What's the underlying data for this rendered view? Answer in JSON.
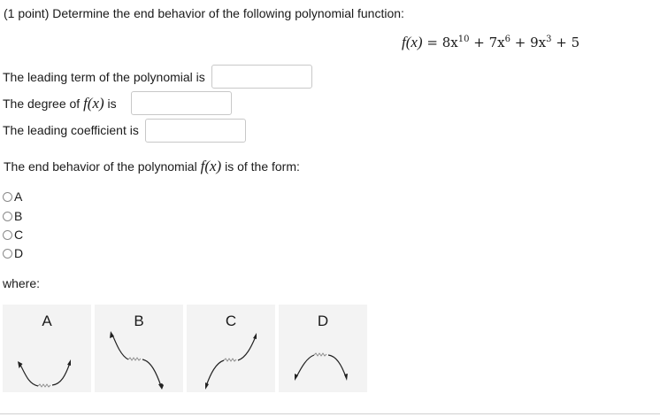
{
  "problem": {
    "header": "(1 point) Determine the end behavior of the following polynomial function:",
    "formula": {
      "lhs": "f(x)",
      "eq": "=",
      "terms": [
        "8x",
        "10",
        "+ 7x",
        "6",
        "+ 9x",
        "3",
        "+ 5"
      ]
    }
  },
  "fields": [
    {
      "label": "The leading term of the polynomial is",
      "value": ""
    },
    {
      "label_pre": "The degree of",
      "label_f": "f(x)",
      "label_post": "is",
      "value": ""
    },
    {
      "label": "The leading coefficient is",
      "value": ""
    }
  ],
  "question": {
    "pre": "The end behavior of the polynomial",
    "f": "f(x)",
    "post": "is of the form:"
  },
  "options": [
    "A",
    "B",
    "C",
    "D"
  ],
  "where_label": "where:",
  "graphs": [
    {
      "label": "A",
      "shape": "both-ends-up"
    },
    {
      "label": "B",
      "shape": "up-left-down-right"
    },
    {
      "label": "C",
      "shape": "down-left-up-right"
    },
    {
      "label": "D",
      "shape": "both-ends-down"
    }
  ]
}
